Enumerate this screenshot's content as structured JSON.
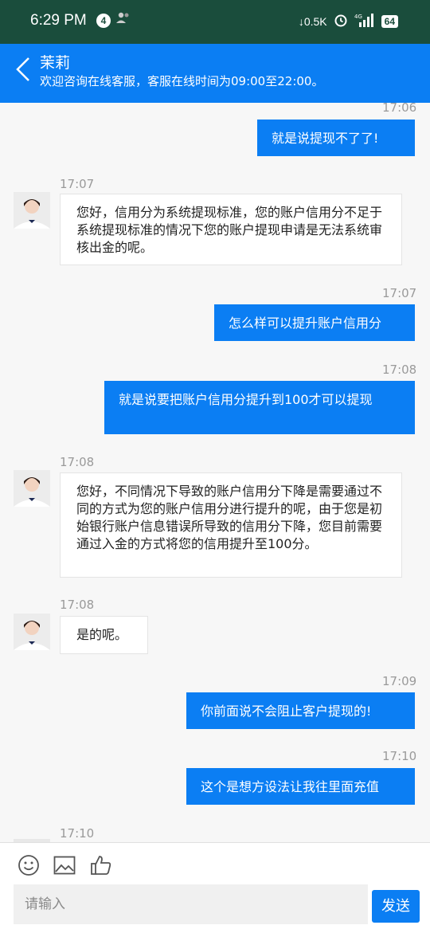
{
  "status_bar": {
    "time": "6:29 PM",
    "notification_count": "4",
    "network_speed": "0.5K",
    "signal_type": "4G",
    "battery": "64"
  },
  "header": {
    "name": "茉莉",
    "subtitle": "欢迎咨询在线客服，客服在线时间为09:00至22:00。"
  },
  "messages": [
    {
      "time": "17:06",
      "side": "out",
      "text": "就是说提现不了了!"
    },
    {
      "time": "17:07",
      "side": "in",
      "text": "您好，信用分为系统提现标准，您的账户信用分不足于系统提现标准的情况下您的账户提现申请是无法系统审核出金的呢。"
    },
    {
      "time": "17:07",
      "side": "out",
      "text": "怎么样可以提升账户信用分"
    },
    {
      "time": "17:08",
      "side": "out",
      "text": "就是说要把账户信用分提升到100才可以提现"
    },
    {
      "time": "17:08",
      "side": "in",
      "text": "您好，不同情况下导致的账户信用分下降是需要通过不同的方式为您的账户信用分进行提升的呢，由于您是初始银行账户信息错误所导致的信用分下降，您目前需要通过入金的方式将您的信用提升至100分。"
    },
    {
      "time": "17:08",
      "side": "in",
      "text": "是的呢。"
    },
    {
      "time": "17:09",
      "side": "out",
      "text": "你前面说不会阻止客户提现的!"
    },
    {
      "time": "17:10",
      "side": "out",
      "text": "这个是想方设法让我往里面充值"
    },
    {
      "time": "17:10",
      "side": "in",
      "text": ""
    }
  ],
  "input": {
    "placeholder": "请输入",
    "send_label": "发送"
  },
  "colors": {
    "accent": "#0b7ef3",
    "status_bar": "#1a4d3c"
  }
}
